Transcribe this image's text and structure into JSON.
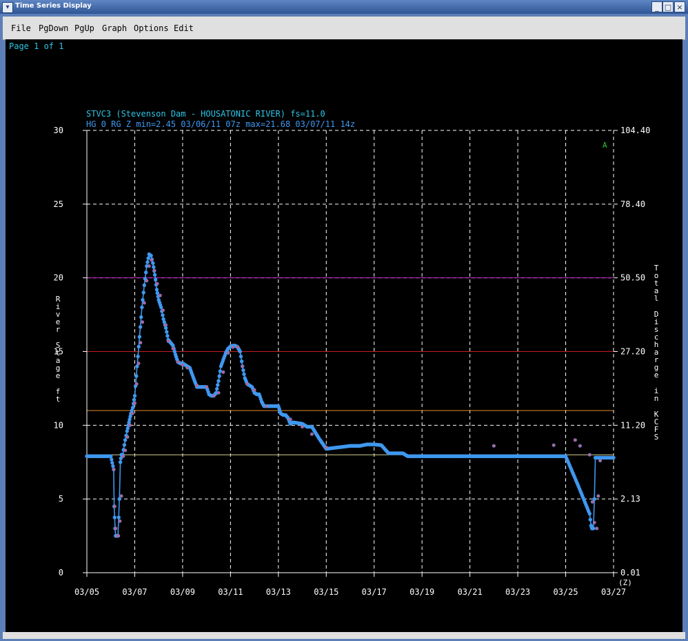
{
  "window": {
    "title": "Time Series Display",
    "controls": {
      "minimize": "_",
      "maximize": "□",
      "close": "×"
    }
  },
  "menu": [
    "File",
    "PgDown",
    "PgUp",
    "Graph",
    "Options",
    "Edit"
  ],
  "page_label": "Page 1 of 1",
  "header_line1": "STVC3 (Stevenson Dam - HOUSATONIC RIVER) fs=11.0",
  "header_line2": "HG 0 RG Z min=2.45 03/06/11 07z max=21.68 03/07/11 14z",
  "series_marker": "A",
  "colors": {
    "background": "#000000",
    "axis": "#ffffff",
    "grid": "#ffffff",
    "series": "#3f98f0",
    "observed_dots": "#c85a8a",
    "header_text": "#2cc6e6",
    "line_20": "#c020c0",
    "line_15": "#c81e1e",
    "line_11": "#e88a2a",
    "line_8": "#d8d090"
  },
  "chart_data": {
    "type": "line",
    "title": "STVC3 (Stevenson Dam - HOUSATONIC RIVER) fs=11.0",
    "subtitle": "HG 0 RG Z min=2.45 03/06/11 07z max=21.68 03/07/11 14z",
    "ylabel": "River Stage ft",
    "ylabel_right": "Total Discharge in KCFS",
    "xlabel_unit": "(Z)",
    "ylim": [
      0,
      30
    ],
    "y_ticks": [
      "0",
      "5",
      "10",
      "15",
      "20",
      "25",
      "30"
    ],
    "y_right_ticks": [
      "0.01",
      "2.13",
      "11.20",
      "27.20",
      "50.50",
      "78.40",
      "104.40"
    ],
    "xlim_days": [
      0,
      22
    ],
    "x_ticks": [
      "03/05",
      "03/07",
      "03/09",
      "03/11",
      "03/13",
      "03/15",
      "03/17",
      "03/19",
      "03/21",
      "03/23",
      "03/25",
      "03/27"
    ],
    "grid": true,
    "threshold_lines": [
      {
        "y": 20,
        "color": "#c020c0"
      },
      {
        "y": 15,
        "color": "#c81e1e"
      },
      {
        "y": 11,
        "color": "#e88a2a"
      },
      {
        "y": 8,
        "color": "#d8d090"
      }
    ],
    "series": [
      {
        "x": [
          0.0,
          1.0,
          1.12,
          1.14,
          1.18,
          1.2,
          1.22,
          1.3,
          1.36,
          1.4,
          1.44,
          1.5,
          1.6,
          1.68,
          1.76,
          1.84,
          1.92,
          2.0,
          2.1,
          2.2,
          2.3,
          2.4,
          2.5,
          2.6,
          2.68,
          2.76,
          2.84,
          2.92,
          3.0,
          3.1,
          3.2,
          3.3,
          3.4,
          3.5,
          3.6,
          3.7,
          3.8,
          3.9,
          3.95,
          4.0,
          4.1,
          4.2,
          4.3,
          4.5,
          4.6,
          4.8,
          5.0,
          5.1,
          5.2,
          5.3,
          5.4,
          5.5,
          5.6,
          5.8,
          5.9,
          6.0,
          6.1,
          6.2,
          6.3,
          6.4,
          6.5,
          6.6,
          6.7,
          6.8,
          6.9,
          7.0,
          7.1,
          7.2,
          7.3,
          7.4,
          7.5,
          7.6,
          7.7,
          7.8,
          7.9,
          8.0,
          8.1,
          8.2,
          8.3,
          8.4,
          8.5,
          8.6,
          9.0,
          9.2,
          9.4,
          9.7,
          10.0,
          10.5,
          11.0,
          11.2,
          11.4,
          11.7,
          12.0,
          12.3,
          12.6,
          12.8,
          13.0,
          13.1,
          13.2,
          13.3,
          13.4,
          13.6,
          14.0,
          15.0,
          16.0,
          17.0,
          18.0,
          19.0,
          20.0,
          20.5,
          21.0,
          21.06,
          21.1,
          21.16,
          21.2,
          21.24,
          21.3,
          21.4,
          21.5,
          22.0
        ],
        "y": [
          7.9,
          7.9,
          7.0,
          4.5,
          3.0,
          2.5,
          2.5,
          2.5,
          5.0,
          7.5,
          8.0,
          8.0,
          9.0,
          9.6,
          10.2,
          10.8,
          11.2,
          12.0,
          14.0,
          16.0,
          18.0,
          19.5,
          20.8,
          21.6,
          21.5,
          21.0,
          20.2,
          19.2,
          18.5,
          18.0,
          17.2,
          16.6,
          15.8,
          15.6,
          15.4,
          14.8,
          14.3,
          14.2,
          14.2,
          14.2,
          14.1,
          14.0,
          13.9,
          13.0,
          12.6,
          12.6,
          12.6,
          12.1,
          12.0,
          12.0,
          12.2,
          13.0,
          14.0,
          14.9,
          15.2,
          15.35,
          15.4,
          15.4,
          15.3,
          15.0,
          14.0,
          13.2,
          12.8,
          12.7,
          12.6,
          12.2,
          12.1,
          12.1,
          11.6,
          11.3,
          11.3,
          11.3,
          11.3,
          11.3,
          11.3,
          11.3,
          10.8,
          10.7,
          10.7,
          10.5,
          10.1,
          10.2,
          10.1,
          9.9,
          9.9,
          9.1,
          8.4,
          8.5,
          8.6,
          8.6,
          8.6,
          8.7,
          8.7,
          8.65,
          8.1,
          8.1,
          8.1,
          8.1,
          8.1,
          8.0,
          7.9,
          7.9,
          7.9,
          7.9,
          7.9,
          7.9,
          7.9,
          7.9,
          7.9,
          6.0,
          4.0,
          3.2,
          3.0,
          3.0,
          5.0,
          7.8,
          7.8,
          7.8,
          7.8,
          7.8
        ]
      }
    ],
    "observed_points": {
      "x": [
        1.12,
        1.16,
        1.2,
        1.26,
        1.32,
        1.38,
        1.44,
        1.52,
        1.6,
        1.7,
        1.8,
        1.9,
        2.0,
        2.08,
        2.16,
        2.24,
        2.32,
        2.4,
        2.5,
        2.6,
        2.7,
        2.82,
        2.94,
        3.06,
        3.18,
        3.3,
        3.4,
        3.6,
        3.8,
        4.0,
        4.2,
        4.6,
        5.0,
        5.3,
        5.5,
        5.7,
        5.9,
        6.1,
        6.3,
        6.5,
        6.7,
        7.0,
        7.5,
        8.5,
        9.0,
        9.4,
        10.0,
        17.0,
        19.5,
        20.4,
        20.6,
        21.0,
        21.12,
        21.2,
        21.3,
        21.36,
        21.44
      ],
      "y": [
        7.0,
        4.5,
        3.0,
        2.5,
        2.5,
        3.5,
        5.2,
        7.9,
        8.3,
        9.2,
        10.0,
        10.8,
        11.5,
        12.8,
        14.2,
        15.6,
        17.0,
        18.3,
        19.8,
        20.8,
        21.2,
        20.5,
        19.6,
        18.8,
        17.8,
        16.8,
        15.7,
        15.2,
        14.3,
        14.1,
        13.9,
        12.7,
        12.6,
        12.0,
        12.2,
        13.6,
        14.9,
        15.3,
        15.3,
        14.0,
        12.8,
        12.4,
        11.3,
        10.4,
        9.9,
        9.4,
        8.5,
        8.6,
        8.65,
        9.0,
        8.6,
        8.0,
        4.8,
        3.4,
        3.0,
        5.2,
        7.6
      ]
    }
  }
}
